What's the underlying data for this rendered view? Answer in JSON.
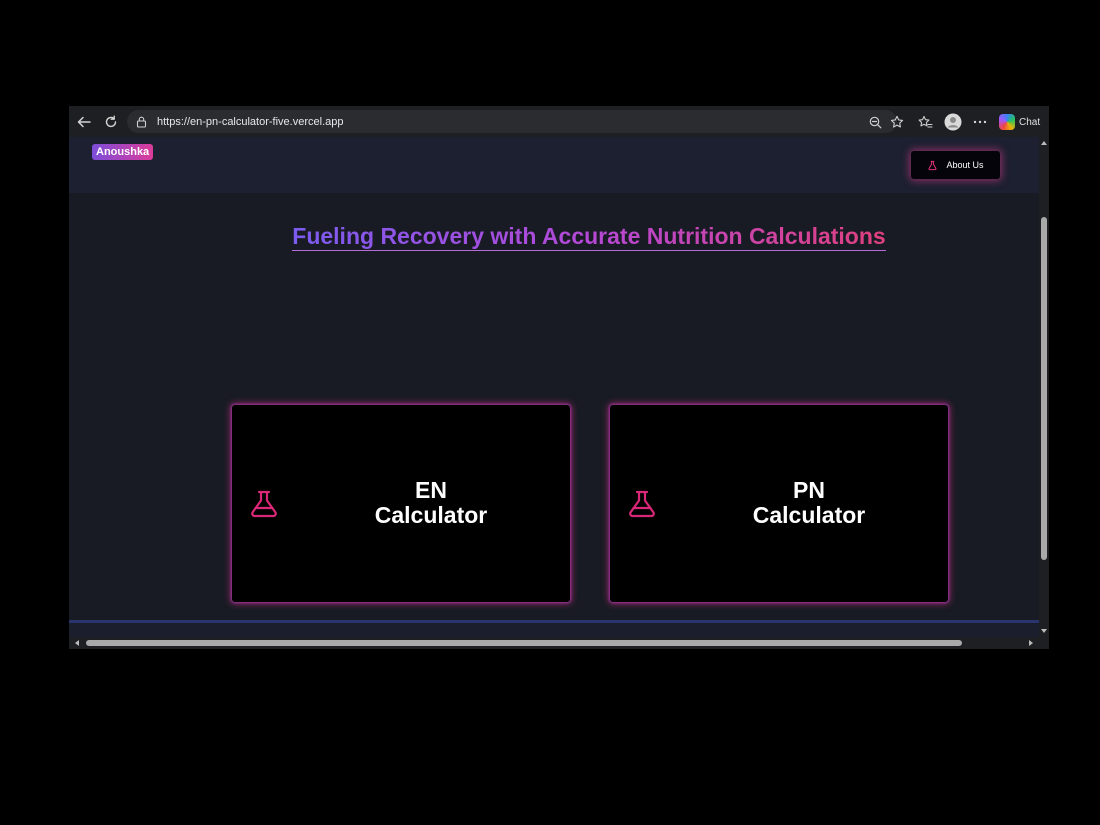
{
  "browser": {
    "url": "https://en-pn-calculator-five.vercel.app",
    "chat_label": "Chat",
    "icons": [
      "back-arrow-icon",
      "refresh-icon",
      "lock-icon",
      "zoom-out-icon",
      "favorite-star-icon",
      "favorites-icon",
      "profile-icon",
      "more-icon",
      "copilot-icon"
    ]
  },
  "navbar": {
    "brand": "Anoushka",
    "about_button": "About Us"
  },
  "hero": {
    "title": "Fueling Recovery with Accurate Nutrition Calculations"
  },
  "cards": [
    {
      "title": "EN\nCalculator",
      "icon": "flask-icon"
    },
    {
      "title": "PN\nCalculator",
      "icon": "flask-icon"
    }
  ],
  "colors": {
    "accent_pink": "#db2777",
    "accent_purple": "#7b5cf0",
    "page_background": "#181b24"
  }
}
